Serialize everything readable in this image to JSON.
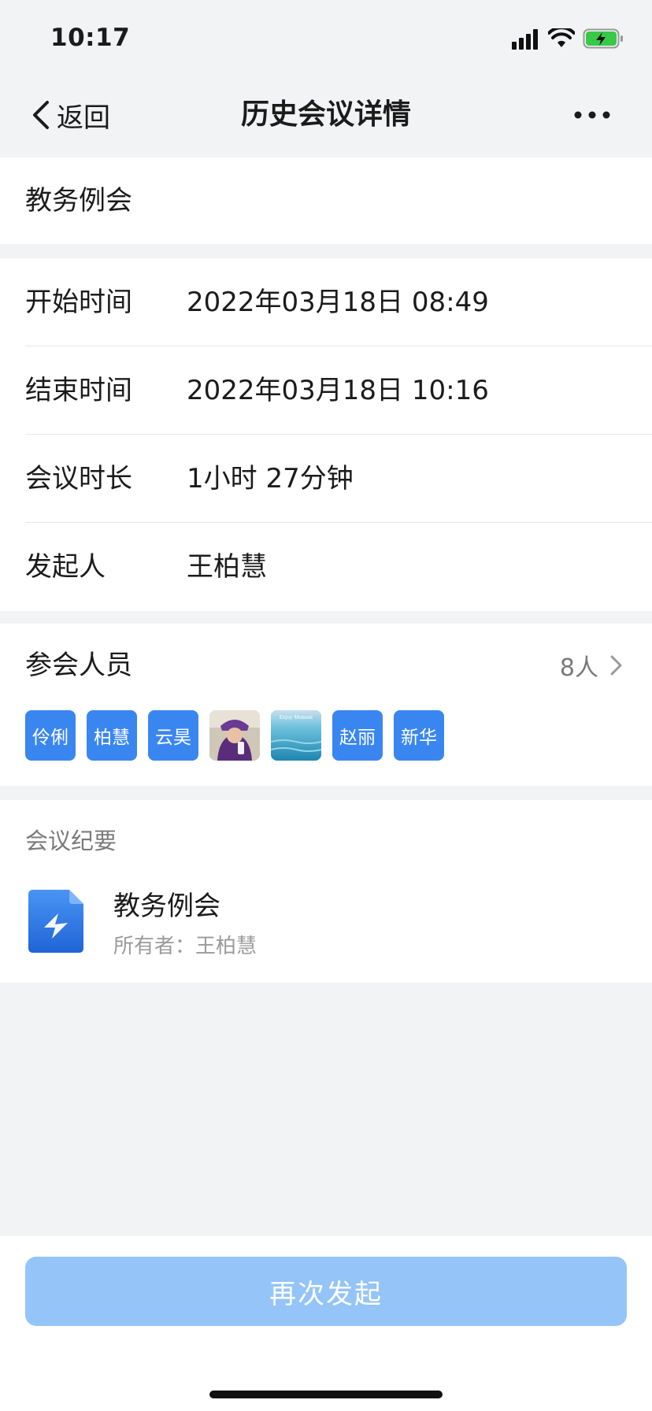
{
  "status_bar": {
    "time": "10:17"
  },
  "nav": {
    "back_label": "返回",
    "title": "历史会议详情"
  },
  "meeting": {
    "title": "教务例会"
  },
  "info": {
    "rows": [
      {
        "label": "开始时间",
        "value": "2022年03月18日  08:49"
      },
      {
        "label": "结束时间",
        "value": "2022年03月18日  10:16"
      },
      {
        "label": "会议时长",
        "value": "1小时 27分钟"
      },
      {
        "label": "发起人",
        "value": "王柏慧"
      }
    ]
  },
  "participants": {
    "title": "参会人员",
    "count": "8人",
    "avatars": [
      {
        "text": "伶俐"
      },
      {
        "text": "柏慧"
      },
      {
        "text": "云昊"
      },
      {
        "text": ""
      },
      {
        "text": ""
      },
      {
        "text": "赵丽"
      },
      {
        "text": "新华"
      }
    ],
    "photo_overlay_text": "Enjoy Moment"
  },
  "minutes": {
    "header": "会议纪要",
    "doc_title": "教务例会",
    "owner_label": "所有者：",
    "owner_name": "王柏慧"
  },
  "bottom": {
    "relaunch_label": "再次发起"
  },
  "colors": {
    "accent": "#3a86f0",
    "button_disabled": "#94c4f8",
    "background": "#f2f3f5",
    "battery_green": "#38c948"
  }
}
